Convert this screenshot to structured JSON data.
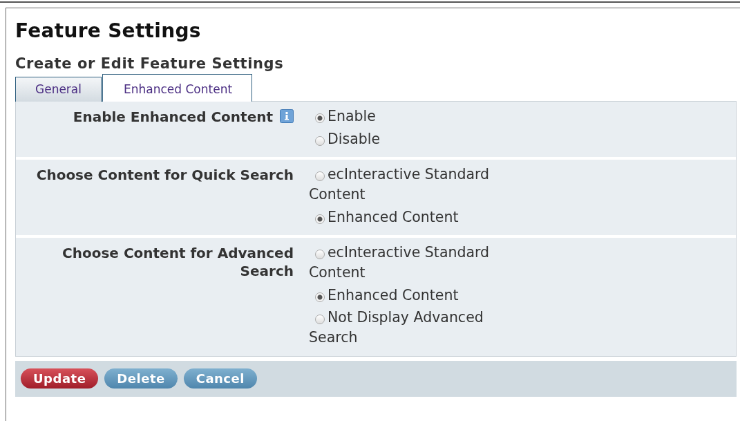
{
  "page": {
    "title": "Feature Settings",
    "subtitle": "Create or Edit Feature Settings"
  },
  "tabs": [
    {
      "label": "General",
      "selected": false
    },
    {
      "label": "Enhanced Content",
      "selected": true
    }
  ],
  "settings": [
    {
      "label": "Enable Enhanced Content",
      "info": true,
      "options": [
        {
          "label": "Enable",
          "selected": true
        },
        {
          "label": "Disable",
          "selected": false
        }
      ]
    },
    {
      "label": "Choose Content for Quick Search",
      "info": false,
      "options": [
        {
          "label": "ecInteractive Standard Content",
          "selected": false
        },
        {
          "label": "Enhanced Content",
          "selected": true
        }
      ]
    },
    {
      "label": "Choose Content for Advanced Search",
      "info": false,
      "options": [
        {
          "label": "ecInteractive Standard Content",
          "selected": false
        },
        {
          "label": "Enhanced Content",
          "selected": true
        },
        {
          "label": "Not Display Advanced Search",
          "selected": false
        }
      ]
    }
  ],
  "buttons": [
    {
      "label": "Update",
      "kind": "primary"
    },
    {
      "label": "Delete",
      "kind": "secondary"
    },
    {
      "label": "Cancel",
      "kind": "secondary"
    }
  ]
}
